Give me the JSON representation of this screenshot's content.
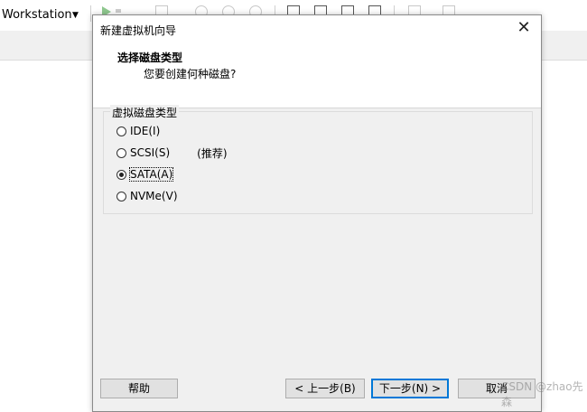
{
  "app": {
    "title": "Workstation"
  },
  "dialog": {
    "title": "新建虚拟机向导",
    "close_glyph": "✕",
    "header_title": "选择磁盘类型",
    "header_subtitle": "您要创建何种磁盘?",
    "group_label": "虚拟磁盘类型",
    "options": [
      {
        "label": "IDE(I)",
        "selected": false
      },
      {
        "label": "SCSI(S)",
        "selected": false,
        "note": "(推荐)"
      },
      {
        "label": "SATA(A)",
        "selected": true
      },
      {
        "label": "NVMe(V)",
        "selected": false
      }
    ],
    "buttons": {
      "help": "帮助",
      "back": "< 上一步(B)",
      "next": "下一步(N) >",
      "cancel": "取消"
    }
  },
  "watermark": "CSDN @zhao先森"
}
